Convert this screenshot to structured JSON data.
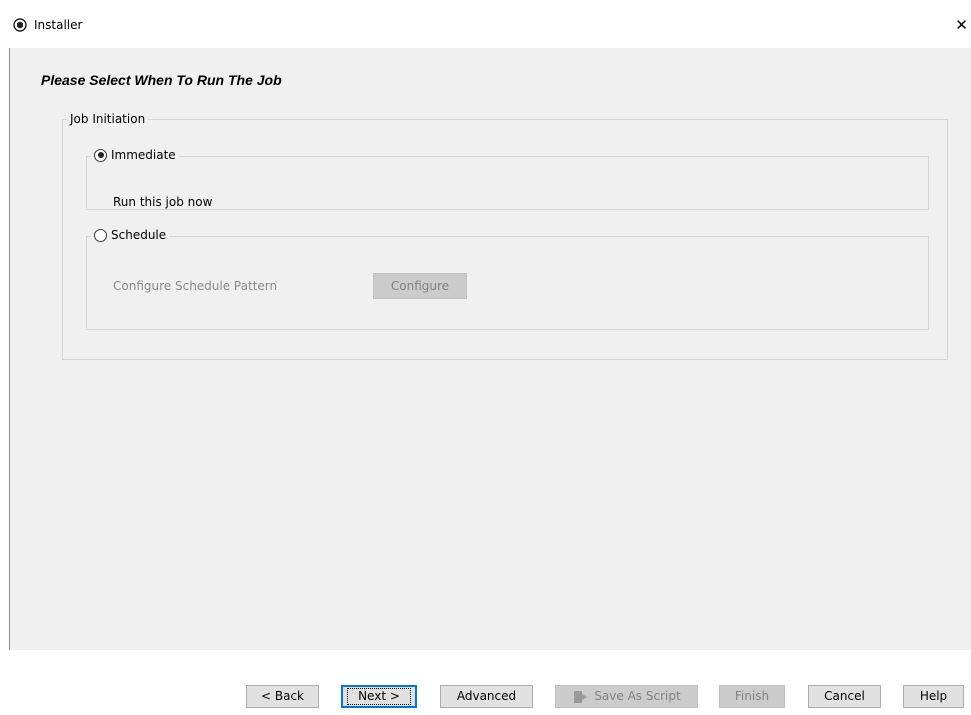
{
  "window": {
    "title": "Installer",
    "close_glyph": "✕",
    "app_icon": "installer-app-icon"
  },
  "page": {
    "title": "Please Select When To Run The Job"
  },
  "job_initiation": {
    "legend": "Job Initiation",
    "immediate": {
      "label": "Immediate",
      "selected": true,
      "description": "Run this job now"
    },
    "schedule": {
      "label": "Schedule",
      "selected": false,
      "pattern_label": "Configure Schedule Pattern",
      "configure_button": "Configure",
      "configure_enabled": false
    }
  },
  "buttons": {
    "back": "< Back",
    "next": "Next >",
    "advanced": "Advanced",
    "save_as_script": "Save As Script",
    "save_icon": "script-save-icon",
    "finish": "Finish",
    "cancel": "Cancel",
    "help": "Help"
  },
  "colors": {
    "panel_bg": "#f0f0f0",
    "button_bg": "#e1e1e1",
    "disabled_bg": "#cccccc",
    "focus_border": "#0078d7"
  }
}
